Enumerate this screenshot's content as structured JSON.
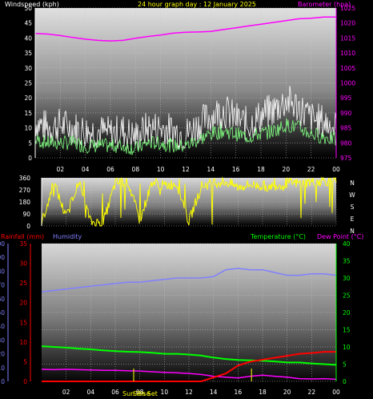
{
  "colors": {
    "wind_label": "#ffffff",
    "title": "#ffff00",
    "barometer": "#ff00ff",
    "rainfall": "#ff0000",
    "humidity": "#8080ff",
    "temperature": "#00ff00",
    "dewpoint": "#ff00ff",
    "winddir": "#ffff00",
    "sun_marker": "#ffff00"
  },
  "chart_data": [
    {
      "type": "line",
      "panel": "wind-barometer",
      "title": "24 hour graph day : 12 January 2025",
      "ylabel_left": "Windspeed (kph)",
      "ylabel_right": "Barometer (hpa)",
      "x_ticks": [
        "02",
        "04",
        "06",
        "08",
        "10",
        "12",
        "14",
        "16",
        "18",
        "20",
        "22",
        "00"
      ],
      "y_left_ticks": [
        "0",
        "5",
        "10",
        "15",
        "20",
        "25",
        "30",
        "35",
        "40",
        "45",
        "50"
      ],
      "y_right_ticks": [
        "975",
        "980",
        "985",
        "990",
        "995",
        "1000",
        "1005",
        "1010",
        "1015",
        "1020",
        "1025"
      ],
      "ylim_left": [
        0,
        50
      ],
      "ylim_right": [
        975,
        1025
      ],
      "grid": true,
      "series": [
        {
          "name": "Barometer (hpa)",
          "axis": "right",
          "x": [
            0,
            1,
            2,
            3,
            4,
            5,
            6,
            7,
            8,
            9,
            10,
            11,
            12,
            13,
            14,
            15,
            16,
            17,
            18,
            19,
            20,
            21,
            22,
            23,
            24
          ],
          "values": [
            1016.5,
            1016.3,
            1015.8,
            1015.2,
            1014.6,
            1014.2,
            1014.0,
            1014.2,
            1014.9,
            1015.5,
            1016.0,
            1016.6,
            1016.9,
            1017.0,
            1017.2,
            1017.8,
            1018.4,
            1019.0,
            1019.6,
            1020.2,
            1020.8,
            1021.4,
            1021.6,
            1022.0,
            1022.0
          ]
        },
        {
          "name": "Wind gust",
          "axis": "left",
          "x": [
            0,
            1,
            2,
            3,
            4,
            5,
            6,
            7,
            8,
            9,
            10,
            11,
            12,
            13,
            14,
            15,
            16,
            17,
            18,
            19,
            20,
            21,
            22,
            23,
            24
          ],
          "values": [
            12,
            10,
            11,
            10,
            9,
            9,
            8,
            9,
            7,
            10,
            10,
            9,
            8,
            11,
            14,
            16,
            13,
            11,
            14,
            16,
            19,
            17,
            13,
            12,
            10
          ]
        },
        {
          "name": "Wind average",
          "axis": "left",
          "x": [
            0,
            1,
            2,
            3,
            4,
            5,
            6,
            7,
            8,
            9,
            10,
            11,
            12,
            13,
            14,
            15,
            16,
            17,
            18,
            19,
            20,
            21,
            22,
            23,
            24
          ],
          "values": [
            6,
            5,
            5,
            5,
            4,
            4,
            4,
            4,
            3,
            5,
            5,
            4,
            4,
            6,
            8,
            9,
            8,
            7,
            8,
            9,
            11,
            10,
            8,
            7,
            6
          ]
        }
      ]
    },
    {
      "type": "scatter",
      "panel": "wind-direction",
      "y_ticks": [
        "360",
        "270",
        "180",
        "90",
        "0"
      ],
      "right_labels": [
        "N",
        "W",
        "S",
        "E",
        "N"
      ],
      "ylim": [
        0,
        360
      ],
      "grid": true,
      "series": [
        {
          "name": "Wind direction",
          "x": [
            0,
            1,
            2,
            3,
            4,
            5,
            6,
            7,
            8,
            9,
            10,
            11,
            12,
            13,
            14,
            15,
            16,
            17,
            18,
            19,
            20,
            21,
            22,
            23,
            24
          ],
          "values": [
            20,
            330,
            60,
            340,
            30,
            20,
            320,
            340,
            40,
            330,
            300,
            320,
            30,
            300,
            320,
            330,
            290,
            310,
            300,
            300,
            320,
            320,
            330,
            340,
            330
          ]
        }
      ]
    },
    {
      "type": "line",
      "panel": "rain-humidity-temperature",
      "legend": [
        "Rainfall (mm)",
        "Humidity",
        "Temperature (°C)",
        "Dew Point (°C)"
      ],
      "x_ticks": [
        "02",
        "04",
        "06",
        "08",
        "10",
        "12",
        "14",
        "16",
        "18",
        "20",
        "22",
        "00"
      ],
      "humidity_ticks": [
        "0",
        "10",
        "20",
        "30",
        "40",
        "50",
        "60",
        "70",
        "80",
        "90",
        "100"
      ],
      "rainfall_ticks": [
        "0",
        "5",
        "10",
        "15",
        "20",
        "25",
        "30",
        "35"
      ],
      "temperature_ticks": [
        "0",
        "5",
        "10",
        "15",
        "20",
        "25",
        "30",
        "35",
        "40"
      ],
      "ylim_humidity": [
        0,
        100
      ],
      "ylim_rainfall": [
        0,
        35
      ],
      "ylim_temperature": [
        0,
        40
      ],
      "annotations": [
        "Sun Rise",
        "Sun Set"
      ],
      "grid": true,
      "series": [
        {
          "name": "Humidity",
          "axis": "humidity",
          "x": [
            0,
            1,
            2,
            3,
            4,
            5,
            6,
            7,
            8,
            9,
            10,
            11,
            12,
            13,
            14,
            15,
            16,
            17,
            18,
            19,
            20,
            21,
            22,
            23,
            24
          ],
          "values": [
            65,
            66,
            67,
            68,
            69,
            70,
            71,
            72,
            72,
            73,
            74,
            75,
            75,
            75,
            76,
            81,
            82,
            81,
            81,
            79,
            77,
            77,
            78,
            78,
            77
          ]
        },
        {
          "name": "Rainfall (mm)",
          "axis": "rainfall",
          "x": [
            0,
            1,
            2,
            3,
            4,
            5,
            6,
            7,
            8,
            9,
            10,
            11,
            12,
            13,
            14,
            15,
            16,
            17,
            18,
            19,
            20,
            21,
            22,
            23,
            24
          ],
          "values": [
            0,
            0,
            0,
            0,
            0,
            0,
            0,
            0,
            0,
            0,
            0,
            0,
            0,
            0,
            1,
            2,
            4,
            5,
            5.5,
            6,
            6.5,
            7,
            7.2,
            7.5,
            7.5
          ]
        },
        {
          "name": "Temperature (°C)",
          "axis": "temperature",
          "x": [
            0,
            1,
            2,
            3,
            4,
            5,
            6,
            7,
            8,
            9,
            10,
            11,
            12,
            13,
            14,
            15,
            16,
            17,
            18,
            19,
            20,
            21,
            22,
            23,
            24
          ],
          "values": [
            10.2,
            10.0,
            9.8,
            9.5,
            9.3,
            9.0,
            8.8,
            8.6,
            8.5,
            8.3,
            8.0,
            8.0,
            7.8,
            7.5,
            6.9,
            6.5,
            6.2,
            6.1,
            6.0,
            5.8,
            5.5,
            5.5,
            5.2,
            5.0,
            4.8
          ]
        },
        {
          "name": "Dew Point (°C)",
          "axis": "temperature",
          "x": [
            0,
            1,
            2,
            3,
            4,
            5,
            6,
            7,
            8,
            9,
            10,
            11,
            12,
            13,
            14,
            15,
            16,
            17,
            18,
            19,
            20,
            21,
            22,
            23,
            24
          ],
          "values": [
            3.5,
            3.4,
            3.5,
            3.4,
            3.3,
            3.2,
            3.2,
            3.1,
            3.0,
            2.8,
            2.6,
            2.5,
            2.3,
            2.0,
            1.5,
            1.2,
            1.0,
            1.5,
            1.8,
            1.5,
            1.2,
            0.8,
            0.7,
            0.8,
            0.6
          ]
        }
      ]
    }
  ]
}
